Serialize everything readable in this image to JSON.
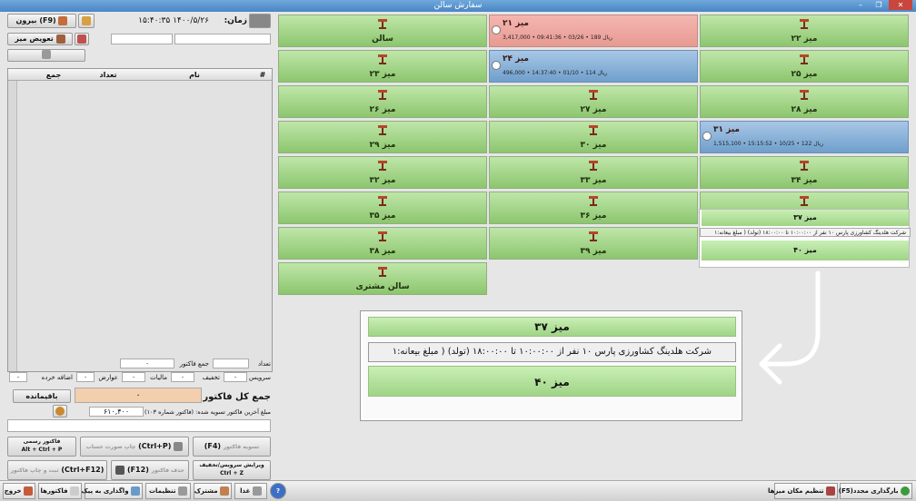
{
  "window": {
    "title": "سفارش سالن"
  },
  "tables": [
    {
      "name": "سالن",
      "col": 2,
      "row": 0,
      "state": "free"
    },
    {
      "name": "میز ۲۱",
      "col": 1,
      "row": 0,
      "state": "red",
      "detail": "ریال 189 • 03/26 • 09:41:36 • 3,417,000"
    },
    {
      "name": "میز ۲۲",
      "col": 0,
      "row": 0,
      "state": "free"
    },
    {
      "name": "میز ۲۳",
      "col": 2,
      "row": 1,
      "state": "free"
    },
    {
      "name": "میز ۲۴",
      "col": 1,
      "row": 1,
      "state": "blue",
      "detail": "ریال 114 • 01/10 • 14:37:40 • 496,000"
    },
    {
      "name": "میز ۲۵",
      "col": 0,
      "row": 1,
      "state": "free"
    },
    {
      "name": "میز ۲۶",
      "col": 2,
      "row": 2,
      "state": "free"
    },
    {
      "name": "میز ۲۷",
      "col": 1,
      "row": 2,
      "state": "free"
    },
    {
      "name": "میز ۲۸",
      "col": 0,
      "row": 2,
      "state": "free"
    },
    {
      "name": "میز ۲۹",
      "col": 2,
      "row": 3,
      "state": "free"
    },
    {
      "name": "میز ۳۰",
      "col": 1,
      "row": 3,
      "state": "free"
    },
    {
      "name": "میز ۳۱",
      "col": 0,
      "row": 3,
      "state": "blue",
      "detail": "ریال 122 • 10/25 • 15:15:52 • 1,515,100"
    },
    {
      "name": "میز ۳۲",
      "col": 2,
      "row": 4,
      "state": "free"
    },
    {
      "name": "میز ۳۳",
      "col": 1,
      "row": 4,
      "state": "free"
    },
    {
      "name": "میز ۳۴",
      "col": 0,
      "row": 4,
      "state": "free"
    },
    {
      "name": "میز ۳۵",
      "col": 2,
      "row": 5,
      "state": "free"
    },
    {
      "name": "میز ۳۶",
      "col": 1,
      "row": 5,
      "state": "free"
    },
    {
      "name": "میز ۳۷",
      "col": 0,
      "row": 5,
      "state": "free"
    },
    {
      "name": "میز ۳۸",
      "col": 2,
      "row": 6,
      "state": "free"
    },
    {
      "name": "میز ۳۹",
      "col": 1,
      "row": 6,
      "state": "free"
    },
    {
      "name": "سالن مشتری",
      "col": 2,
      "row": 7,
      "state": "free"
    }
  ],
  "popup": {
    "reservation": "شرکت هلدینگ کشاورزی پارس ۱۰ نفر از ۱۰:۰۰:۰۰ تا ۱۸:۰۰:۰۰ (تولد) ( مبلغ بیعانه:۱",
    "table_name": "میز ۴۰",
    "above_name": "میز ۳۷"
  },
  "zoom": {
    "above_name": "میز ۳۷",
    "reservation": "شرکت هلدینگ کشاورزی پارس ۱۰ نفر از ۱۰:۰۰:۰۰ تا ۱۸:۰۰:۰۰ (تولد) ( مبلغ بیعانه:۱",
    "table_name": "میز ۴۰"
  },
  "left": {
    "time_label": "زمان:",
    "time_value": "۱۴۰۰/۵/۲۶  ۱۵:۴۰:۳۵",
    "exit_button": "(F9) بیرون",
    "change_table": "تعویض میز",
    "order_header": {
      "num": "#",
      "name": "نام",
      "qty": "تعداد",
      "total": "جمع"
    },
    "summary": {
      "count_label": "تعداد",
      "count_value": "",
      "invoice_total_label": "جمع فاکتور",
      "invoice_total_value": "۰",
      "service_label": "سرویس",
      "service_value": "۰",
      "discount_label": "تخفیف",
      "discount_value": "۰",
      "tax_label": "مالیات",
      "tax_value": "۰",
      "duty_label": "عوارض",
      "duty_value": "۰",
      "rounding_label": "اضافه خرده",
      "rounding_value": "۰"
    },
    "grand_total_label": "جمع کل فاکتور :",
    "grand_total_value": "۰",
    "remaining_button": "باقیمانده",
    "last_invoice_label": "مبلغ آخرین فاکتور تسویه شده: (فاکتور شماره ۱۰۳)",
    "last_invoice_value": "۶۱۰,۴۰۰",
    "btn_f4": "(F4)",
    "btn_f4_prefix": "تسویه فاکتور",
    "btn_ctrlp": "(Ctrl+P)",
    "btn_ctrlp_prefix": "چاپ صورت حساب",
    "btn_official": "فاکتور رسمی",
    "btn_official_sc": "Alt + Ctrl + P",
    "btn_ctrlf12": "(Ctrl+F12)",
    "btn_ctrlf12_prefix": "ثبت و چاپ فاکتور",
    "btn_f12": "(F12)",
    "btn_f12_prefix": "حذف فاکتور",
    "btn_edit": "ویرایش سرویس/تخفیف",
    "btn_edit_sc": "Ctrl + Z"
  },
  "taskbar": {
    "reload": "بارگذاری مجدد(F5)",
    "layout": "تنظیم مکان میزها",
    "exit": "خروج",
    "invoices": "فاکتورها",
    "pager": "واگذاری به پیک",
    "settings": "تنظیمات",
    "subscriber": "مشترک",
    "food": "غذا"
  },
  "colors": {
    "free": "#8cc66e",
    "red": "#e79a92",
    "blue": "#6f9fcc"
  }
}
